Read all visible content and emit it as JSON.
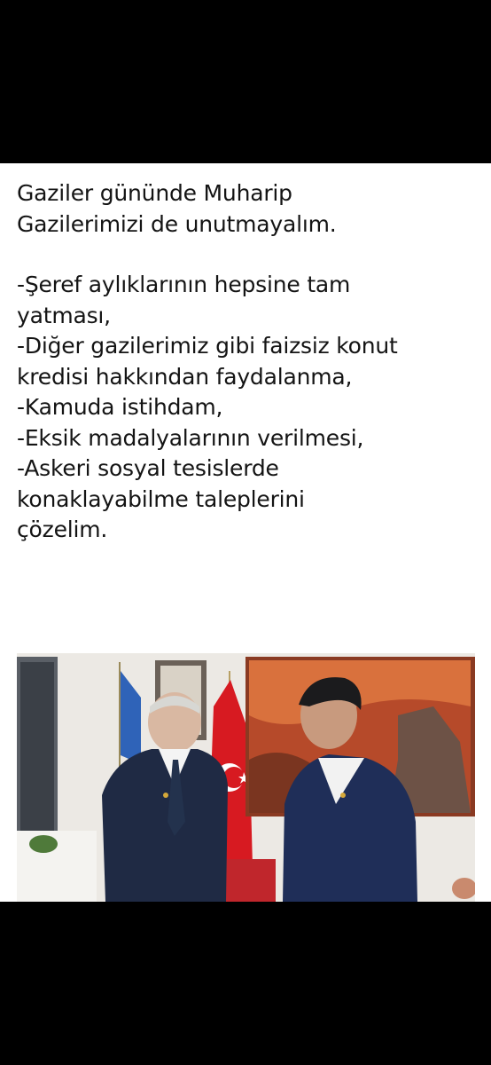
{
  "post": {
    "lines": [
      "Gaziler gününde Muharip",
      "Gazilerimizi de unutmayalım.",
      "-Şeref aylıklarının hepsine tam",
      "yatması,",
      "-Diğer gazilerimiz gibi faizsiz konut",
      "kredisi hakkından faydalanma,",
      "-Kamuda istihdam,",
      "-Eksik madalyalarının verilmesi,",
      "-Askeri sosyal tesislerde",
      "konaklayabilme taleplerini",
      "çözelim."
    ]
  },
  "photo": {
    "subject": "two-men-standing-with-turkish-flag",
    "colors": {
      "flag_red": "#d71a21",
      "suit_navy": "#1f2a44",
      "wall": "#ece9e4",
      "painting": "#b64a2a"
    }
  },
  "colors": {
    "background": "#000000",
    "card": "#ffffff",
    "text": "#141414"
  }
}
